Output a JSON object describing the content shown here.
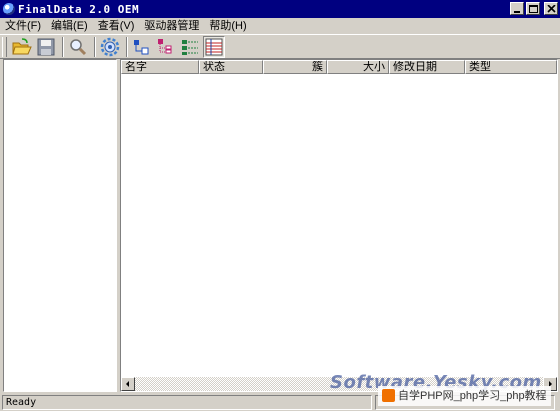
{
  "window": {
    "title": "FinalData 2.0 OEM"
  },
  "menubar": {
    "items": [
      {
        "label": "文件(F)"
      },
      {
        "label": "编辑(E)"
      },
      {
        "label": "查看(V)"
      },
      {
        "label": "驱动器管理"
      },
      {
        "label": "帮助(H)"
      }
    ]
  },
  "toolbar": {
    "icons": [
      "open-folder-icon",
      "save-disk-icon",
      "search-icon",
      "settings-gear-icon",
      "tree-view-icon",
      "list-view-icon",
      "detail-view-icon",
      "table-view-icon"
    ]
  },
  "file_list": {
    "columns": [
      "名字",
      "状态",
      "簇",
      "大小",
      "修改日期",
      "类型"
    ]
  },
  "statusbar": {
    "text": "Ready"
  },
  "watermark": {
    "site": "Software.Yesky.com",
    "php": "自学PHP网_php学习_php教程"
  },
  "colors": {
    "titlebar": "#000080",
    "face": "#d4d0c8",
    "accent_tool": "#2060c0"
  }
}
